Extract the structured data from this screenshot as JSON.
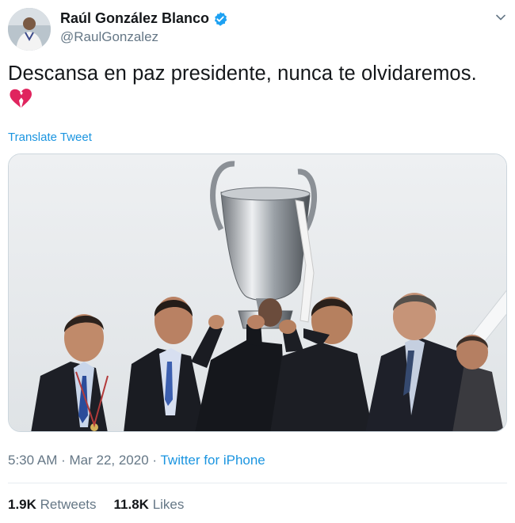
{
  "tweet": {
    "display_name": "Raúl González Blanco",
    "handle": "@RaulGonzalez",
    "text": "Descansa en paz presidente, nunca te olvidaremos.",
    "emoji": "broken-heart-icon",
    "translate_label": "Translate Tweet",
    "time": "5:30 AM",
    "date": "Mar 22, 2020",
    "source": "Twitter for iPhone",
    "retweets_count": "1.9K",
    "retweets_label": "Retweets",
    "likes_count": "11.8K",
    "likes_label": "Likes"
  },
  "colors": {
    "link": "#1b95e0",
    "muted": "#657786",
    "verified": "#1da1f2",
    "heart": "#e0245e"
  },
  "icons": [
    "verified-badge-icon",
    "chevron-down-icon",
    "broken-heart-icon"
  ]
}
